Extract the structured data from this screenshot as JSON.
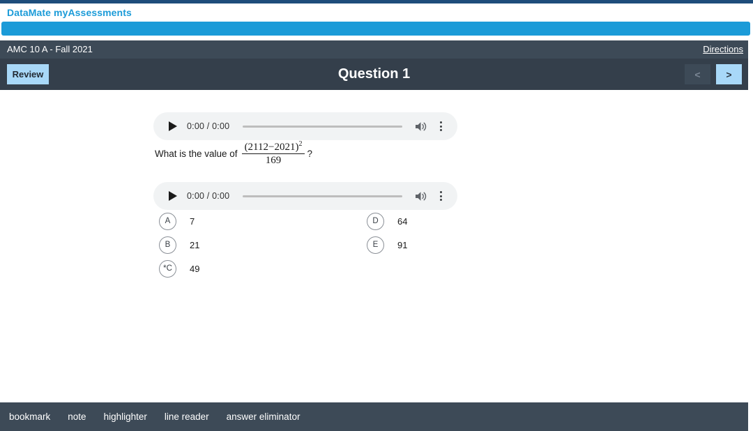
{
  "brand": {
    "title": "DataMate myAssessments",
    "accent_color": "#1b9bd8",
    "top_strip_color": "#1e4d7b"
  },
  "assessment_bar": {
    "name": "AMC 10 A - Fall 2021",
    "directions_label": "Directions",
    "background_color": "#3d4a57"
  },
  "question_header": {
    "review_label": "Review",
    "title": "Question 1",
    "prev_label": "<",
    "next_label": ">",
    "background_color": "#343f4b",
    "active_button_color": "#a8d8f8"
  },
  "audio_players": [
    {
      "time_display": "0:00 / 0:00",
      "play_icon": "play-triangle-icon",
      "volume_icon": "speaker-icon",
      "menu_icon": "kebab-menu-icon"
    },
    {
      "time_display": "0:00 / 0:00",
      "play_icon": "play-triangle-icon",
      "volume_icon": "speaker-icon",
      "menu_icon": "kebab-menu-icon"
    }
  ],
  "question": {
    "lead_text": "What is the value of",
    "trailing_text": "?",
    "math": {
      "numerator_open": "(2112",
      "numerator_minus": "−",
      "numerator_close": "2021)",
      "numerator_exponent": "2",
      "denominator": "169"
    }
  },
  "choices": {
    "left_column": [
      {
        "letter": "A",
        "value": "7"
      },
      {
        "letter": "B",
        "value": "21"
      },
      {
        "letter": "*C",
        "value": "49"
      }
    ],
    "right_column": [
      {
        "letter": "D",
        "value": "64"
      },
      {
        "letter": "E",
        "value": "91"
      }
    ]
  },
  "toolbar": {
    "items": [
      "bookmark",
      "note",
      "highlighter",
      "line reader",
      "answer eliminator"
    ],
    "background_color": "#3d4a57"
  }
}
